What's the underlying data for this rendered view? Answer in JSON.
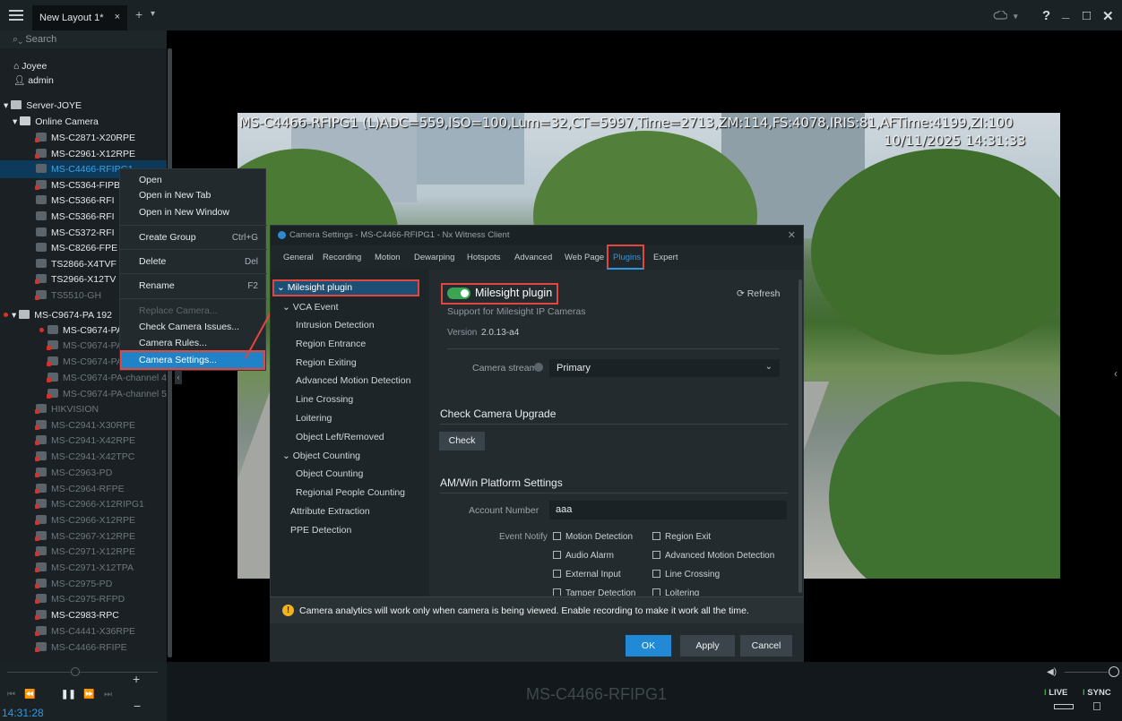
{
  "topbar": {
    "tab_label": "New Layout 1*",
    "tab_close": "×",
    "plus": "+",
    "chevron": "⌄",
    "help": "?",
    "minimize": "_",
    "maximize": "□",
    "close": "✕"
  },
  "tree": {
    "search_placeholder": "Search",
    "user_site": "Joyee",
    "user": "admin",
    "server": "Server-JOYE",
    "folder": "Online Camera",
    "cameras": [
      {
        "label": "MS-C2871-X20RPE",
        "state": "normal",
        "red": true
      },
      {
        "label": "MS-C2961-X12RPE",
        "state": "normal",
        "red": true
      },
      {
        "label": "MS-C4466-RFIPG1",
        "state": "selected",
        "red": false
      },
      {
        "label": "MS-C5364-FIPB",
        "state": "normal",
        "red": true
      },
      {
        "label": "MS-C5366-RFI",
        "state": "normal",
        "red": false
      },
      {
        "label": "MS-C5366-RFI",
        "state": "normal",
        "red": false
      },
      {
        "label": "MS-C5372-RFI",
        "state": "normal",
        "red": false
      },
      {
        "label": "MS-C8266-FPE",
        "state": "normal",
        "red": false
      },
      {
        "label": "TS2866-X4TVF",
        "state": "normal",
        "red": false
      },
      {
        "label": "TS2966-X12TV",
        "state": "normal",
        "red": true
      },
      {
        "label": "TS5510-GH",
        "state": "dim",
        "red": true
      }
    ],
    "nvr": "MS-C9674-PA 192",
    "nvr_child": "MS-C9674-PA",
    "channels": [
      "MS-C9674-PA-",
      "MS-C9674-PA-",
      "MS-C9674-PA-channel 4",
      "MS-C9674-PA-channel 5"
    ],
    "more": [
      {
        "label": "HIKVISION",
        "dim": true
      },
      {
        "label": "MS-C2941-X30RPE",
        "dim": true
      },
      {
        "label": "MS-C2941-X42RPE",
        "dim": true
      },
      {
        "label": "MS-C2941-X42TPC",
        "dim": true
      },
      {
        "label": "MS-C2963-PD",
        "dim": true
      },
      {
        "label": "MS-C2964-RFPE",
        "dim": true
      },
      {
        "label": "MS-C2966-X12RIPG1",
        "dim": true
      },
      {
        "label": "MS-C2966-X12RPE",
        "dim": true
      },
      {
        "label": "MS-C2967-X12RPE",
        "dim": true
      },
      {
        "label": "MS-C2971-X12RPE",
        "dim": true
      },
      {
        "label": "MS-C2971-X12TPA",
        "dim": true
      },
      {
        "label": "MS-C2975-PD",
        "dim": true
      },
      {
        "label": "MS-C2975-RFPD",
        "dim": true
      },
      {
        "label": "MS-C2983-RPC",
        "dim": false
      },
      {
        "label": "MS-C4441-X36RPE",
        "dim": true
      },
      {
        "label": "MS-C4466-RFIPE",
        "dim": true
      }
    ]
  },
  "context_menu": {
    "open": "Open",
    "open_tab": "Open in New Tab",
    "open_window": "Open in New Window",
    "create_group": "Create Group",
    "create_group_key": "Ctrl+G",
    "delete": "Delete",
    "delete_key": "Del",
    "rename": "Rename",
    "rename_key": "F2",
    "replace": "Replace Camera...",
    "check_issues": "Check Camera Issues...",
    "rules": "Camera Rules...",
    "settings": "Camera Settings..."
  },
  "video": {
    "osd_line1": "MS-C4466-RFIPG1 (L)ADC=559,ISO=100,Lum=32,CT=5997,Time=2713,ZM:114,FS:4078,IRIS:81,AFTime:4199,ZI:100",
    "osd_line2": "10/11/2025 14:31:33"
  },
  "dialog": {
    "title": "Camera Settings - MS-C4466-RFIPG1 - Nx Witness Client",
    "close": "✕",
    "tabs": [
      "General",
      "Recording",
      "Motion",
      "Dewarping",
      "Hotspots",
      "Advanced",
      "Web Page",
      "Plugins",
      "Expert"
    ],
    "left": {
      "plugin": "Milesight plugin",
      "vca": "VCA Event",
      "vca_items": [
        "Intrusion Detection",
        "Region Entrance",
        "Region Exiting",
        "Advanced Motion Detection",
        "Line Crossing",
        "Loitering",
        "Object Left/Removed"
      ],
      "oc": "Object Counting",
      "oc_items": [
        "Object Counting",
        "Regional People Counting"
      ],
      "attr": "Attribute Extraction",
      "ppe": "PPE Detection"
    },
    "plugin_name": "Milesight plugin",
    "refresh": "Refresh",
    "support": "Support for Milesight IP Cameras",
    "version_label": "Version",
    "version": "2.0.13-a4",
    "stream_label": "Camera stream",
    "stream_value": "Primary",
    "upgrade_title": "Check Camera Upgrade",
    "check": "Check",
    "am_title": "AM/Win Platform Settings",
    "account_label": "Account Number",
    "account_value": "aaa",
    "event_label": "Event Notify",
    "events": [
      "Motion Detection",
      "Region Exit",
      "Audio Alarm",
      "Advanced Motion Detection",
      "External Input",
      "Line Crossing",
      "Tamper Detection",
      "Loitering"
    ],
    "warning": "Camera analytics will work only when camera is being viewed. Enable recording to make it work all the time.",
    "ok": "OK",
    "apply": "Apply",
    "cancel": "Cancel"
  },
  "bottom": {
    "time": "14:31:28",
    "camera": "MS-C4466-RFIPG1",
    "live": "LIVE",
    "sync": "SYNC",
    "plus": "+",
    "minus": "−"
  }
}
